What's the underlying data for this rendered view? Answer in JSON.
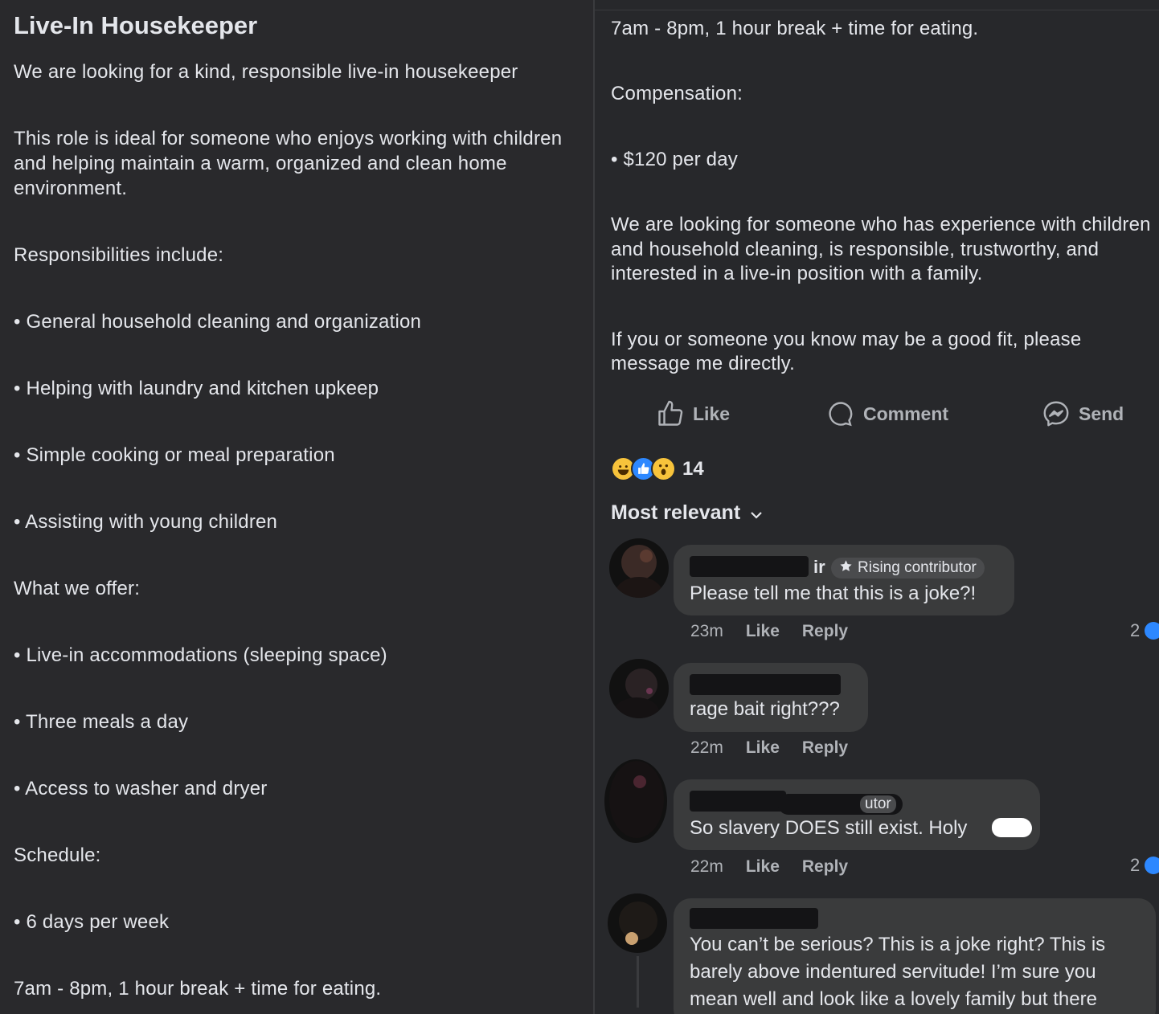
{
  "post": {
    "title": "Live-In Housekeeper",
    "intro": "We are looking for a kind, responsible live-in housekeeper",
    "ideal_line1": "This role is ideal for someone who enjoys working with children",
    "ideal_line2": "and helping maintain a warm, organized and clean home",
    "ideal_line3": "environment.",
    "responsibilities_heading": "Responsibilities include:",
    "responsibilities": [
      "• General household cleaning and organization",
      "• Helping with laundry and kitchen upkeep",
      "• Simple cooking or meal preparation",
      "• Assisting with young children"
    ],
    "offer_heading": "What we offer:",
    "offers": [
      "• Live-in accommodations (sleeping space)",
      "• Three meals a day",
      "• Access to washer and dryer"
    ],
    "schedule_heading": "Schedule:",
    "schedule_days": "• 6 days per week",
    "schedule_hours": "7am - 8pm, 1 hour break + time for eating.",
    "compensation_heading": "Compensation:",
    "compensation": "• $120 per day",
    "looking_line1": "We are looking for someone who has experience with children",
    "looking_line2": "and household cleaning, is responsible, trustworthy, and",
    "looking_line3": "interested in a live-in position with a family.",
    "contact_line1": "If you or someone you know may be a good fit, please",
    "contact_line2": "message me directly."
  },
  "actions": {
    "like": "Like",
    "comment": "Comment",
    "send": "Send"
  },
  "reactions": {
    "count": "14",
    "icons": [
      "haha-emoji-icon",
      "like-emoji-icon",
      "wow-emoji-icon"
    ]
  },
  "sort": {
    "label": "Most relevant"
  },
  "comments": [
    {
      "name_fragment": "ir",
      "badge": "Rising contributor",
      "text": "Please tell me that this is a joke?!",
      "time": "23m",
      "like": "Like",
      "reply": "Reply",
      "reactions": "2"
    },
    {
      "text": "rage bait right???",
      "time": "22m",
      "like": "Like",
      "reply": "Reply"
    },
    {
      "badge": "utor",
      "text": "So slavery DOES still exist. Holy",
      "time": "22m",
      "like": "Like",
      "reply": "Reply",
      "reactions": "2"
    },
    {
      "text_line1": "You can’t be serious?  This is a joke right? This is",
      "text_line2": "barely above indentured servitude!   I’m sure you",
      "text_line3": "mean well and look like a lovely family but there"
    }
  ],
  "colors": {
    "background": "#27282b",
    "text": "#e4e6eb",
    "muted": "#b0b3b8",
    "bubble": "#3a3b3c",
    "accent": "#2d88ff"
  }
}
